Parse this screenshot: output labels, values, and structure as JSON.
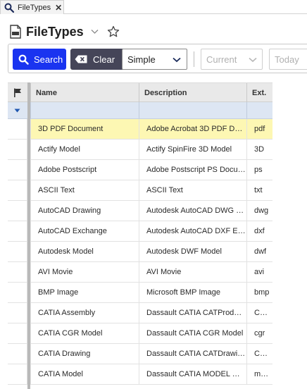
{
  "tab": {
    "label": "FileTypes",
    "close": "✕"
  },
  "page": {
    "title": "FileTypes"
  },
  "toolbar": {
    "search_label": "Search",
    "clear_label": "Clear",
    "mode_value": "Simple",
    "revision_placeholder": "Current",
    "date_placeholder": "Today"
  },
  "grid": {
    "columns": {
      "name": "Name",
      "description": "Description",
      "ext": "Ext."
    },
    "rows": [
      {
        "name": "3D PDF Document",
        "description": "Adobe Acrobat 3D PDF D…",
        "ext": "pdf",
        "selected": true
      },
      {
        "name": "Actify Model",
        "description": "Actify SpinFire 3D Model",
        "ext": "3D"
      },
      {
        "name": "Adobe Postscript",
        "description": "Adobe Postscript PS Docu…",
        "ext": "ps"
      },
      {
        "name": "ASCII Text",
        "description": "ASCII Text",
        "ext": "txt"
      },
      {
        "name": "AutoCAD Drawing",
        "description": "Autodesk AutoCAD DWG …",
        "ext": "dwg"
      },
      {
        "name": "AutoCAD Exchange",
        "description": "Autodesk AutoCAD DXF E…",
        "ext": "dxf"
      },
      {
        "name": "Autodesk Model",
        "description": "Autodesk DWF Model",
        "ext": "dwf"
      },
      {
        "name": "AVI Movie",
        "description": "AVI Movie",
        "ext": "avi"
      },
      {
        "name": "BMP Image",
        "description": "Microsoft BMP Image",
        "ext": "bmp"
      },
      {
        "name": "CATIA Assembly",
        "description": "Dassault CATIA CATProd…",
        "ext": "C…"
      },
      {
        "name": "CATIA CGR Model",
        "description": "Dassault CATIA CGR Model",
        "ext": "cgr"
      },
      {
        "name": "CATIA Drawing",
        "description": "Dassault CATIA CATDrawi…",
        "ext": "C…"
      },
      {
        "name": "CATIA Model",
        "description": "Dassault CATIA MODEL …",
        "ext": "m…"
      }
    ]
  },
  "colors": {
    "search_button": "#1a34f0",
    "clear_button": "#454558",
    "selected_row": "#fdf7b3",
    "filter_row": "#dde6f3"
  },
  "icons": {
    "tab": "search-icon",
    "title": "document-icon",
    "favorite": "star-icon",
    "flag": "flag-icon"
  }
}
